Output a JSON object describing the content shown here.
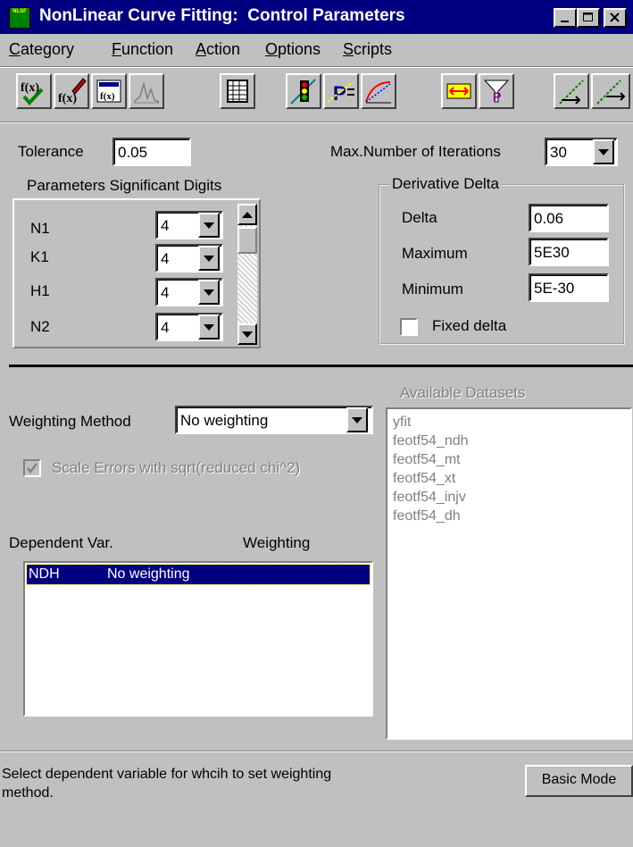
{
  "window": {
    "title": "NonLinear Curve Fitting:  Control Parameters",
    "app_icon_text": "NLSF",
    "minimize_icon": "minimize-icon",
    "maximize_icon": "maximize-icon",
    "close_icon": "close-icon"
  },
  "menu": {
    "items": [
      {
        "pre": "",
        "accel": "C",
        "post": "ategory"
      },
      {
        "pre": "",
        "accel": "F",
        "post": "unction"
      },
      {
        "pre": "",
        "accel": "A",
        "post": "ction"
      },
      {
        "pre": "",
        "accel": "O",
        "post": "ptions"
      },
      {
        "pre": "",
        "accel": "S",
        "post": "cripts"
      }
    ]
  },
  "toolbar": {
    "icons": [
      "function-check-icon",
      "function-edit-icon",
      "function-browse-icon",
      "peak-chart-icon",
      "spreadsheet-icon",
      "traffic-light-icon",
      "parameters-icon",
      "simulate-curve-icon",
      "fit-range-icon",
      "filter-parameters-icon",
      "fit-one-iteration-icon",
      "fit-100-iterations-icon"
    ]
  },
  "params": {
    "tolerance_label": "Tolerance",
    "tolerance_value": "0.05",
    "max_iter_label": "Max.Number of Iterations",
    "max_iter_value": "30",
    "sig_digits_label": "Parameters Significant Digits",
    "rows": [
      {
        "name": "N1",
        "value": "4"
      },
      {
        "name": "K1",
        "value": "4"
      },
      {
        "name": "H1",
        "value": "4"
      },
      {
        "name": "N2",
        "value": "4"
      }
    ]
  },
  "derivative": {
    "title": "Derivative Delta",
    "delta_label": "Delta",
    "delta_value": "0.06",
    "maximum_label": "Maximum",
    "maximum_value": "5E30",
    "minimum_label": "Minimum",
    "minimum_value": "5E-30",
    "fixed_label": "Fixed delta",
    "fixed_checked": false
  },
  "weighting": {
    "method_label": "Weighting Method",
    "method_value": "No weighting",
    "scale_errors_label": "Scale Errors with sqrt(reduced chi^2)",
    "scale_errors_checked": true,
    "dep_var_header": "Dependent Var.",
    "weighting_header": "Weighting",
    "rows": [
      {
        "var": "NDH",
        "weighting": "No weighting",
        "selected": true
      }
    ]
  },
  "datasets": {
    "title": "Available Datasets",
    "items": [
      "yfit",
      "feotf54_ndh",
      "feotf54_mt",
      "feotf54_xt",
      "feotf54_injv",
      "feotf54_dh"
    ]
  },
  "status": {
    "text_line1": "Select dependent variable for whcih to set weighting",
    "text_line2": "method.",
    "basic_mode_label": "Basic Mode"
  }
}
